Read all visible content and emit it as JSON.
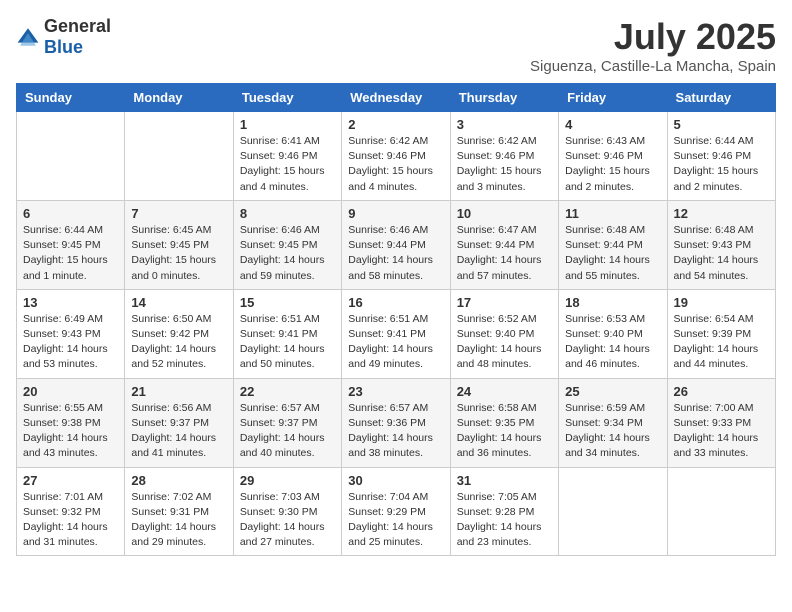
{
  "logo": {
    "general": "General",
    "blue": "Blue"
  },
  "header": {
    "month": "July 2025",
    "location": "Siguenza, Castille-La Mancha, Spain"
  },
  "weekdays": [
    "Sunday",
    "Monday",
    "Tuesday",
    "Wednesday",
    "Thursday",
    "Friday",
    "Saturday"
  ],
  "weeks": [
    [
      {
        "day": "",
        "detail": ""
      },
      {
        "day": "",
        "detail": ""
      },
      {
        "day": "1",
        "detail": "Sunrise: 6:41 AM\nSunset: 9:46 PM\nDaylight: 15 hours\nand 4 minutes."
      },
      {
        "day": "2",
        "detail": "Sunrise: 6:42 AM\nSunset: 9:46 PM\nDaylight: 15 hours\nand 4 minutes."
      },
      {
        "day": "3",
        "detail": "Sunrise: 6:42 AM\nSunset: 9:46 PM\nDaylight: 15 hours\nand 3 minutes."
      },
      {
        "day": "4",
        "detail": "Sunrise: 6:43 AM\nSunset: 9:46 PM\nDaylight: 15 hours\nand 2 minutes."
      },
      {
        "day": "5",
        "detail": "Sunrise: 6:44 AM\nSunset: 9:46 PM\nDaylight: 15 hours\nand 2 minutes."
      }
    ],
    [
      {
        "day": "6",
        "detail": "Sunrise: 6:44 AM\nSunset: 9:45 PM\nDaylight: 15 hours\nand 1 minute."
      },
      {
        "day": "7",
        "detail": "Sunrise: 6:45 AM\nSunset: 9:45 PM\nDaylight: 15 hours\nand 0 minutes."
      },
      {
        "day": "8",
        "detail": "Sunrise: 6:46 AM\nSunset: 9:45 PM\nDaylight: 14 hours\nand 59 minutes."
      },
      {
        "day": "9",
        "detail": "Sunrise: 6:46 AM\nSunset: 9:44 PM\nDaylight: 14 hours\nand 58 minutes."
      },
      {
        "day": "10",
        "detail": "Sunrise: 6:47 AM\nSunset: 9:44 PM\nDaylight: 14 hours\nand 57 minutes."
      },
      {
        "day": "11",
        "detail": "Sunrise: 6:48 AM\nSunset: 9:44 PM\nDaylight: 14 hours\nand 55 minutes."
      },
      {
        "day": "12",
        "detail": "Sunrise: 6:48 AM\nSunset: 9:43 PM\nDaylight: 14 hours\nand 54 minutes."
      }
    ],
    [
      {
        "day": "13",
        "detail": "Sunrise: 6:49 AM\nSunset: 9:43 PM\nDaylight: 14 hours\nand 53 minutes."
      },
      {
        "day": "14",
        "detail": "Sunrise: 6:50 AM\nSunset: 9:42 PM\nDaylight: 14 hours\nand 52 minutes."
      },
      {
        "day": "15",
        "detail": "Sunrise: 6:51 AM\nSunset: 9:41 PM\nDaylight: 14 hours\nand 50 minutes."
      },
      {
        "day": "16",
        "detail": "Sunrise: 6:51 AM\nSunset: 9:41 PM\nDaylight: 14 hours\nand 49 minutes."
      },
      {
        "day": "17",
        "detail": "Sunrise: 6:52 AM\nSunset: 9:40 PM\nDaylight: 14 hours\nand 48 minutes."
      },
      {
        "day": "18",
        "detail": "Sunrise: 6:53 AM\nSunset: 9:40 PM\nDaylight: 14 hours\nand 46 minutes."
      },
      {
        "day": "19",
        "detail": "Sunrise: 6:54 AM\nSunset: 9:39 PM\nDaylight: 14 hours\nand 44 minutes."
      }
    ],
    [
      {
        "day": "20",
        "detail": "Sunrise: 6:55 AM\nSunset: 9:38 PM\nDaylight: 14 hours\nand 43 minutes."
      },
      {
        "day": "21",
        "detail": "Sunrise: 6:56 AM\nSunset: 9:37 PM\nDaylight: 14 hours\nand 41 minutes."
      },
      {
        "day": "22",
        "detail": "Sunrise: 6:57 AM\nSunset: 9:37 PM\nDaylight: 14 hours\nand 40 minutes."
      },
      {
        "day": "23",
        "detail": "Sunrise: 6:57 AM\nSunset: 9:36 PM\nDaylight: 14 hours\nand 38 minutes."
      },
      {
        "day": "24",
        "detail": "Sunrise: 6:58 AM\nSunset: 9:35 PM\nDaylight: 14 hours\nand 36 minutes."
      },
      {
        "day": "25",
        "detail": "Sunrise: 6:59 AM\nSunset: 9:34 PM\nDaylight: 14 hours\nand 34 minutes."
      },
      {
        "day": "26",
        "detail": "Sunrise: 7:00 AM\nSunset: 9:33 PM\nDaylight: 14 hours\nand 33 minutes."
      }
    ],
    [
      {
        "day": "27",
        "detail": "Sunrise: 7:01 AM\nSunset: 9:32 PM\nDaylight: 14 hours\nand 31 minutes."
      },
      {
        "day": "28",
        "detail": "Sunrise: 7:02 AM\nSunset: 9:31 PM\nDaylight: 14 hours\nand 29 minutes."
      },
      {
        "day": "29",
        "detail": "Sunrise: 7:03 AM\nSunset: 9:30 PM\nDaylight: 14 hours\nand 27 minutes."
      },
      {
        "day": "30",
        "detail": "Sunrise: 7:04 AM\nSunset: 9:29 PM\nDaylight: 14 hours\nand 25 minutes."
      },
      {
        "day": "31",
        "detail": "Sunrise: 7:05 AM\nSunset: 9:28 PM\nDaylight: 14 hours\nand 23 minutes."
      },
      {
        "day": "",
        "detail": ""
      },
      {
        "day": "",
        "detail": ""
      }
    ]
  ]
}
